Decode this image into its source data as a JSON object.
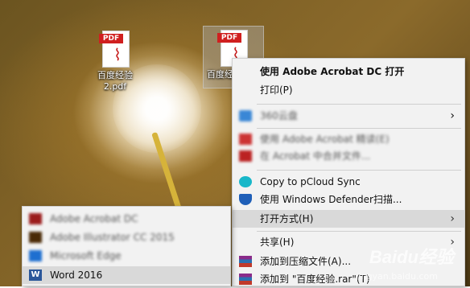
{
  "desktop": {
    "icons": [
      {
        "label": "百度经验\n2.pdf",
        "tag": "PDF"
      },
      {
        "label": "百度经",
        "tag": "PDF"
      }
    ]
  },
  "context_menu": {
    "items": [
      {
        "label": "使用 Adobe Acrobat DC 打开",
        "bold": true
      },
      {
        "label": "打印(P)"
      },
      {
        "label": "360云盘",
        "blurred": true,
        "has_submenu": true
      },
      {
        "label": "使用 Adobe Acrobat 精读(E)",
        "blurred": true
      },
      {
        "label": "在 Acrobat 中合并文件...",
        "blurred": true
      },
      {
        "label": "Copy to pCloud Sync"
      },
      {
        "label": "使用 Windows Defender扫描..."
      },
      {
        "label": "打开方式(H)",
        "has_submenu": true,
        "highlighted": true
      },
      {
        "label": "共享(H)",
        "has_submenu": true
      },
      {
        "label": "添加到压缩文件(A)..."
      },
      {
        "label": "添加到 \"百度经验.rar\"(T)"
      }
    ]
  },
  "open_with_submenu": {
    "items": [
      {
        "label": "Adobe Acrobat DC",
        "blurred": true
      },
      {
        "label": "Adobe Illustrator CC 2015",
        "blurred": true
      },
      {
        "label": "Microsoft Edge",
        "blurred": true
      },
      {
        "label": "Word 2016",
        "highlighted": true
      }
    ]
  },
  "watermark": {
    "brand": "Baidu经验",
    "sub": "jingyan.baidu.com"
  },
  "colors": {
    "pdf_red": "#d01f1f",
    "menu_bg": "#f2f2f2",
    "highlight": "#d9d9d9"
  }
}
